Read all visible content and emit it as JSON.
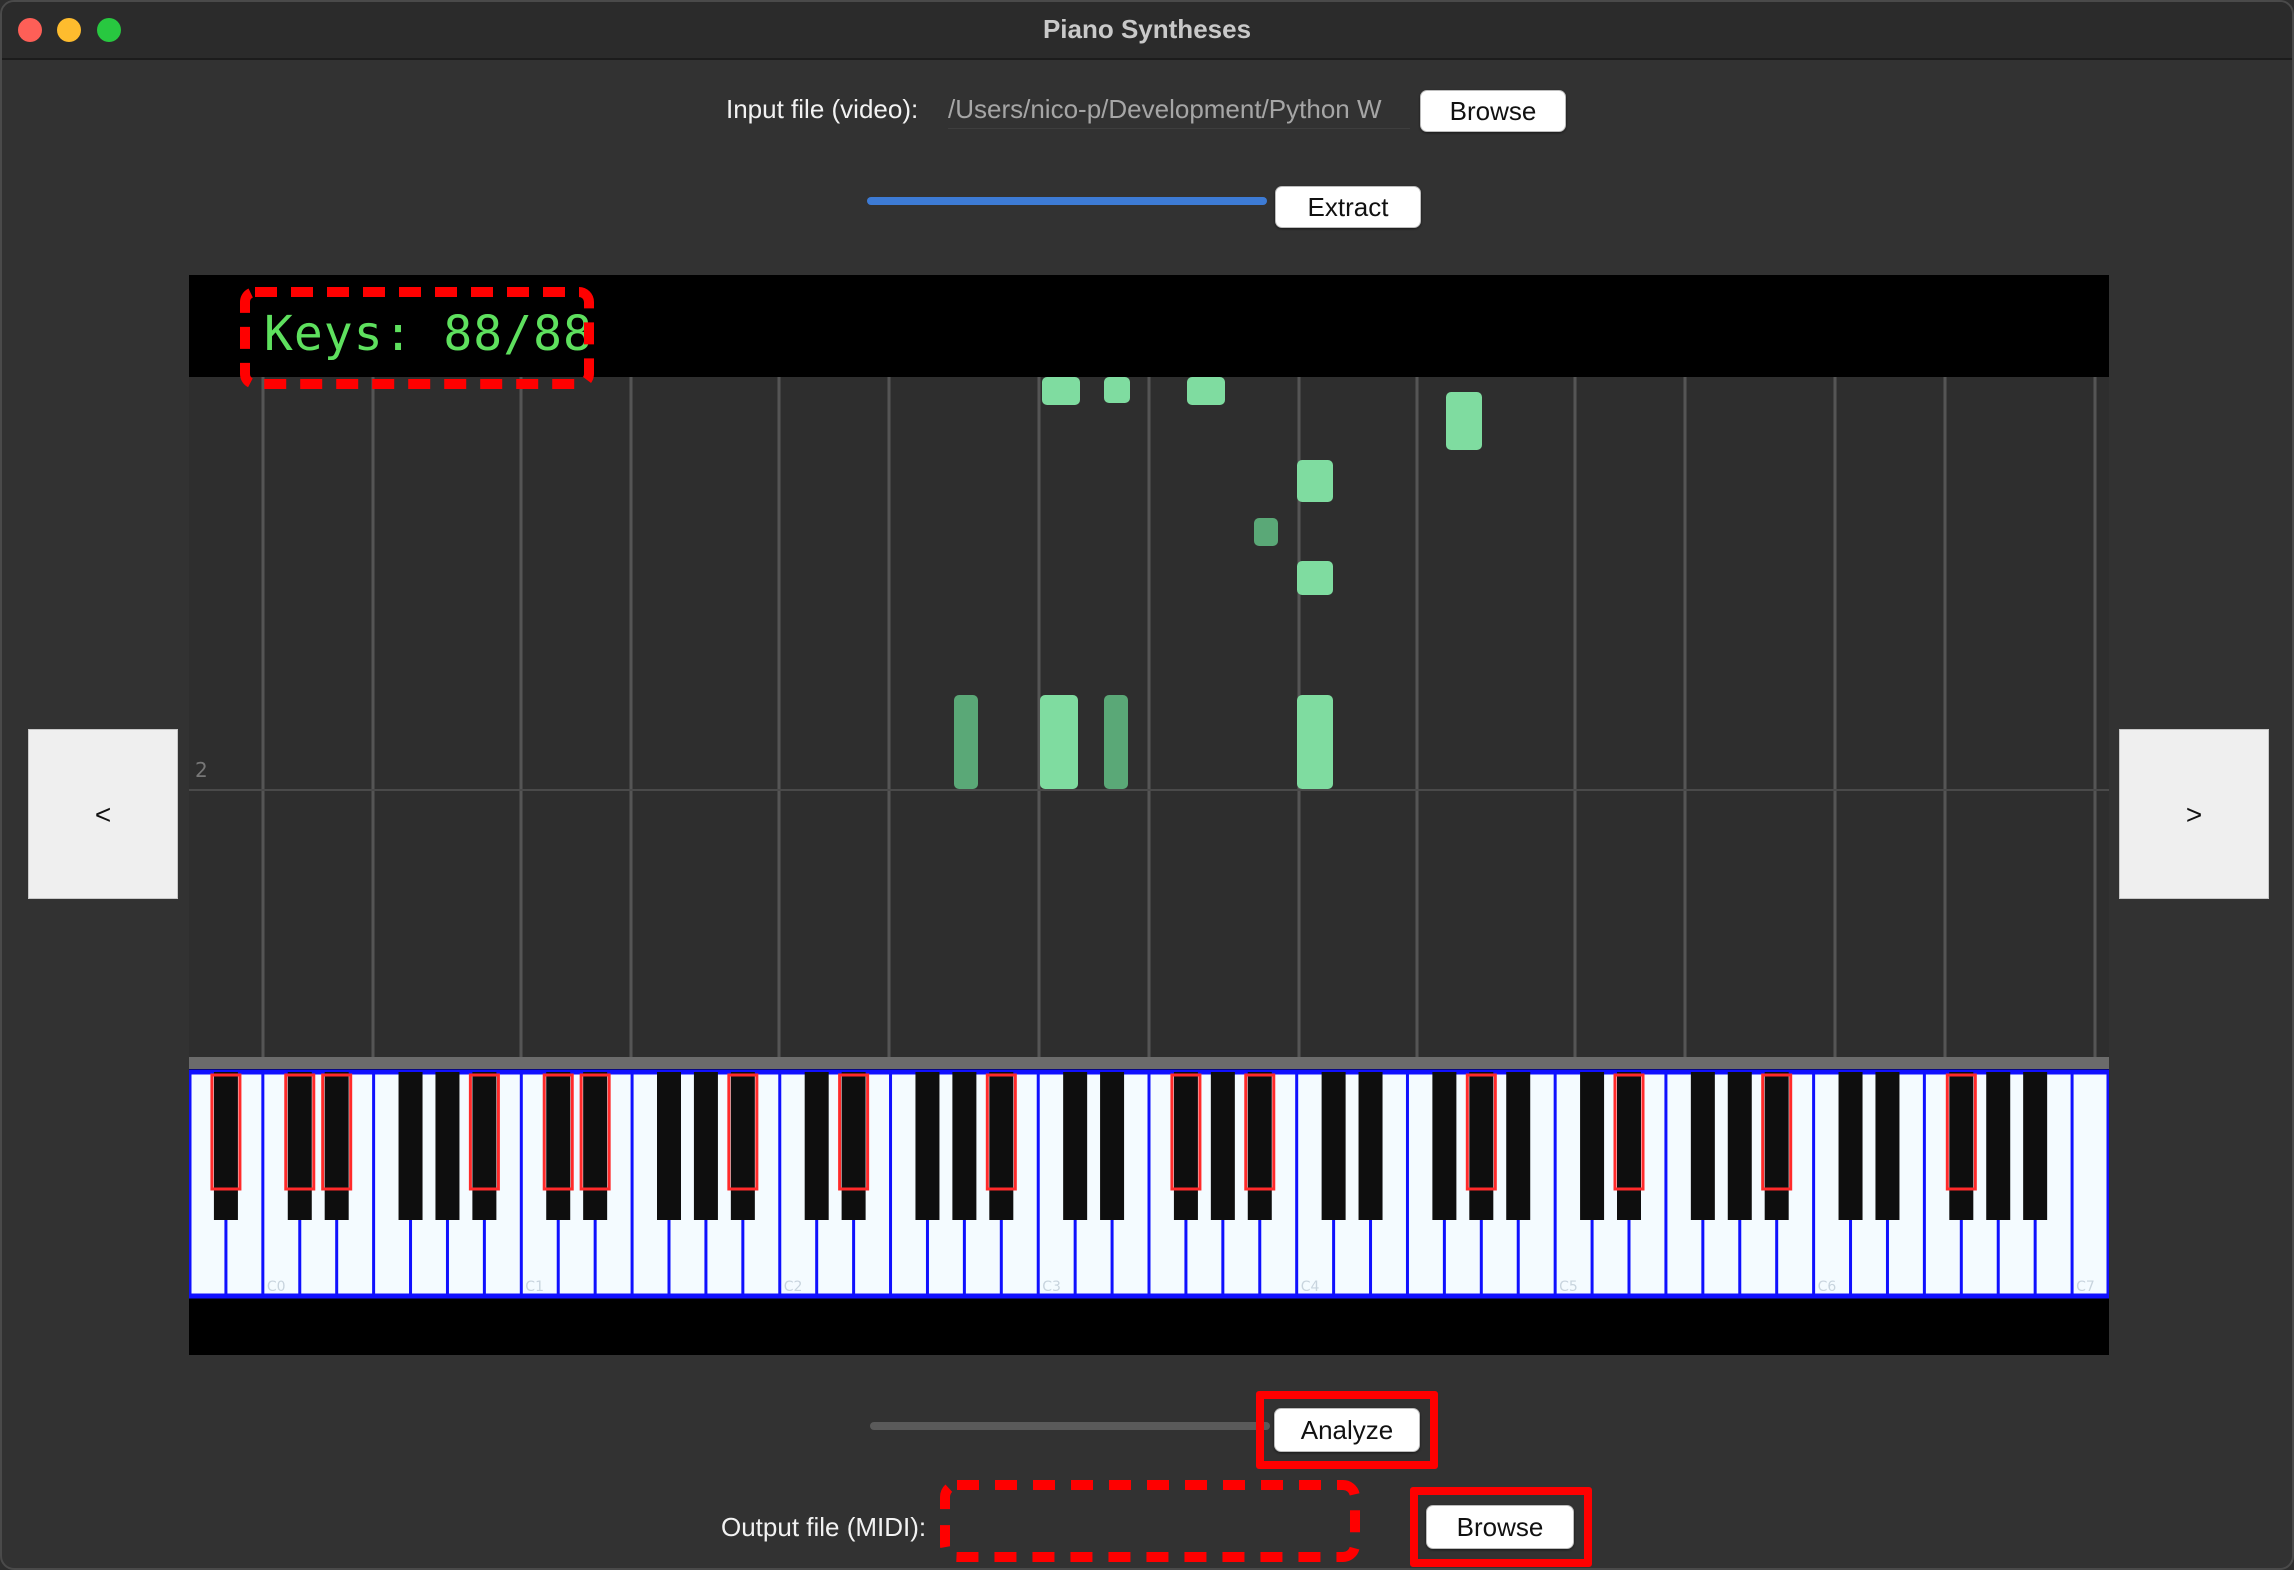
{
  "window": {
    "title": "Piano Syntheses",
    "buttons": [
      "close-icon",
      "minimize-icon",
      "maximize-icon"
    ]
  },
  "input": {
    "label": "Input file (video):",
    "path": "/Users/nico-p/Development/Python W",
    "browse_label": "Browse"
  },
  "extract": {
    "label": "Extract",
    "progress": 1.0,
    "progress_color": "#3d7bd5"
  },
  "preview": {
    "overlay_text": "Keys: 88/88",
    "overlay_color": "#5ee05e",
    "measure_marker": "2",
    "keyboard_outline_color": "#1010ff",
    "pressed_key_color": "#ff2a2a",
    "note_color": "#7fdca0",
    "octave_labels": [
      "C0",
      "C1",
      "C2",
      "C3",
      "C4",
      "C5",
      "C6",
      "C7"
    ]
  },
  "nav": {
    "prev_label": "<",
    "next_label": ">"
  },
  "analyze": {
    "label": "Analyze",
    "progress": 0.0
  },
  "output": {
    "label": "Output file (MIDI):",
    "path": "",
    "browse_label": "Browse"
  },
  "annotations": {
    "highlight_color": "#ff0000"
  }
}
